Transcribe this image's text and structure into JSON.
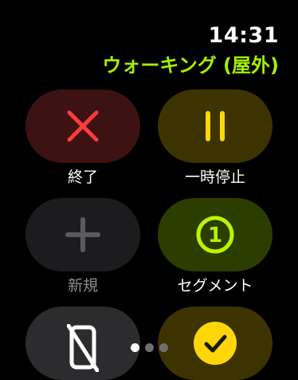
{
  "status": {
    "time": "14:31"
  },
  "workout": {
    "title": "ウォーキング (屋外)"
  },
  "controls": {
    "end": {
      "label": "終了",
      "icon": "x-icon"
    },
    "pause": {
      "label": "一時停止",
      "icon": "pause-icon"
    },
    "new": {
      "label": "新規",
      "icon": "plus-icon"
    },
    "segment": {
      "label": "セグメント",
      "icon": "segment-1-icon",
      "number": "1"
    },
    "water_lock": {
      "icon": "water-lock-phone-icon"
    },
    "done": {
      "icon": "checkmark-icon"
    }
  },
  "pagination": {
    "pages": 3,
    "active_index": 0
  },
  "colors": {
    "background": "#000000",
    "accent_green": "#a6f000",
    "end_bg": "#3d1212",
    "end_icon": "#ff3b3b",
    "pause_bg": "#3d3300",
    "pause_icon": "#ffd60a",
    "new_bg": "#1c1c1e",
    "new_icon": "#5a5a5e",
    "segment_bg": "#2c3d00",
    "segment_icon": "#b7f500",
    "water_bg": "#2c2c2e",
    "done_bg": "#3d3300",
    "done_icon": "#ffd60a"
  }
}
